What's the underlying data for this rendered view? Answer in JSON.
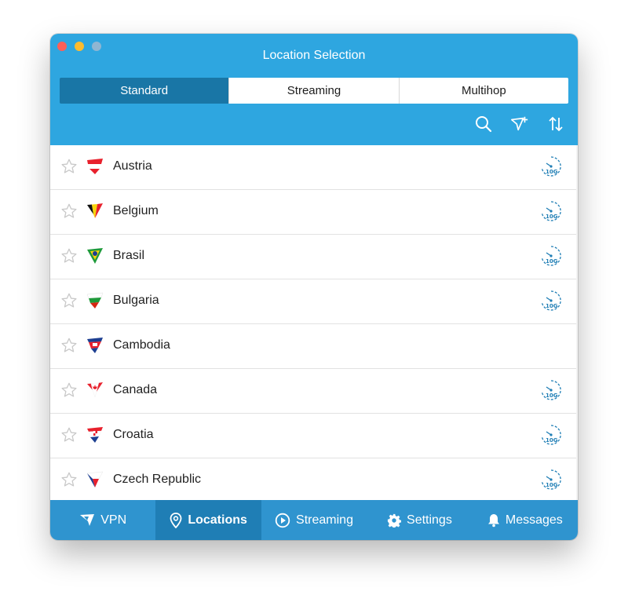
{
  "window": {
    "title": "Location Selection"
  },
  "segments": [
    {
      "label": "Standard",
      "active": true
    },
    {
      "label": "Streaming",
      "active": false
    },
    {
      "label": "Multihop",
      "active": false
    }
  ],
  "toolbar": {
    "icons": [
      "search-icon",
      "add-filter-icon",
      "sort-icon"
    ]
  },
  "locations": [
    {
      "name": "Austria",
      "flag": "austria-flag",
      "speed_badge": "10G"
    },
    {
      "name": "Belgium",
      "flag": "belgium-flag",
      "speed_badge": "10G"
    },
    {
      "name": "Brasil",
      "flag": "brasil-flag",
      "speed_badge": "10G"
    },
    {
      "name": "Bulgaria",
      "flag": "bulgaria-flag",
      "speed_badge": "10G"
    },
    {
      "name": "Cambodia",
      "flag": "cambodia-flag",
      "speed_badge": ""
    },
    {
      "name": "Canada",
      "flag": "canada-flag",
      "speed_badge": "10G"
    },
    {
      "name": "Croatia",
      "flag": "croatia-flag",
      "speed_badge": "10G"
    },
    {
      "name": "Czech Republic",
      "flag": "czech-republic-flag",
      "speed_badge": "10G"
    }
  ],
  "bottom_tabs": [
    {
      "label": "VPN",
      "icon": "vpn-logo-icon",
      "active": false
    },
    {
      "label": "Locations",
      "icon": "location-pin-icon",
      "active": true
    },
    {
      "label": "Streaming",
      "icon": "play-circle-icon",
      "active": false
    },
    {
      "label": "Settings",
      "icon": "gear-icon",
      "active": false
    },
    {
      "label": "Messages",
      "icon": "bell-icon",
      "active": false
    }
  ],
  "colors": {
    "header": "#2ea6e0",
    "segment_active": "#1976a6",
    "bottom_bar": "#2f94cf",
    "bottom_active": "#1f7eb5"
  }
}
